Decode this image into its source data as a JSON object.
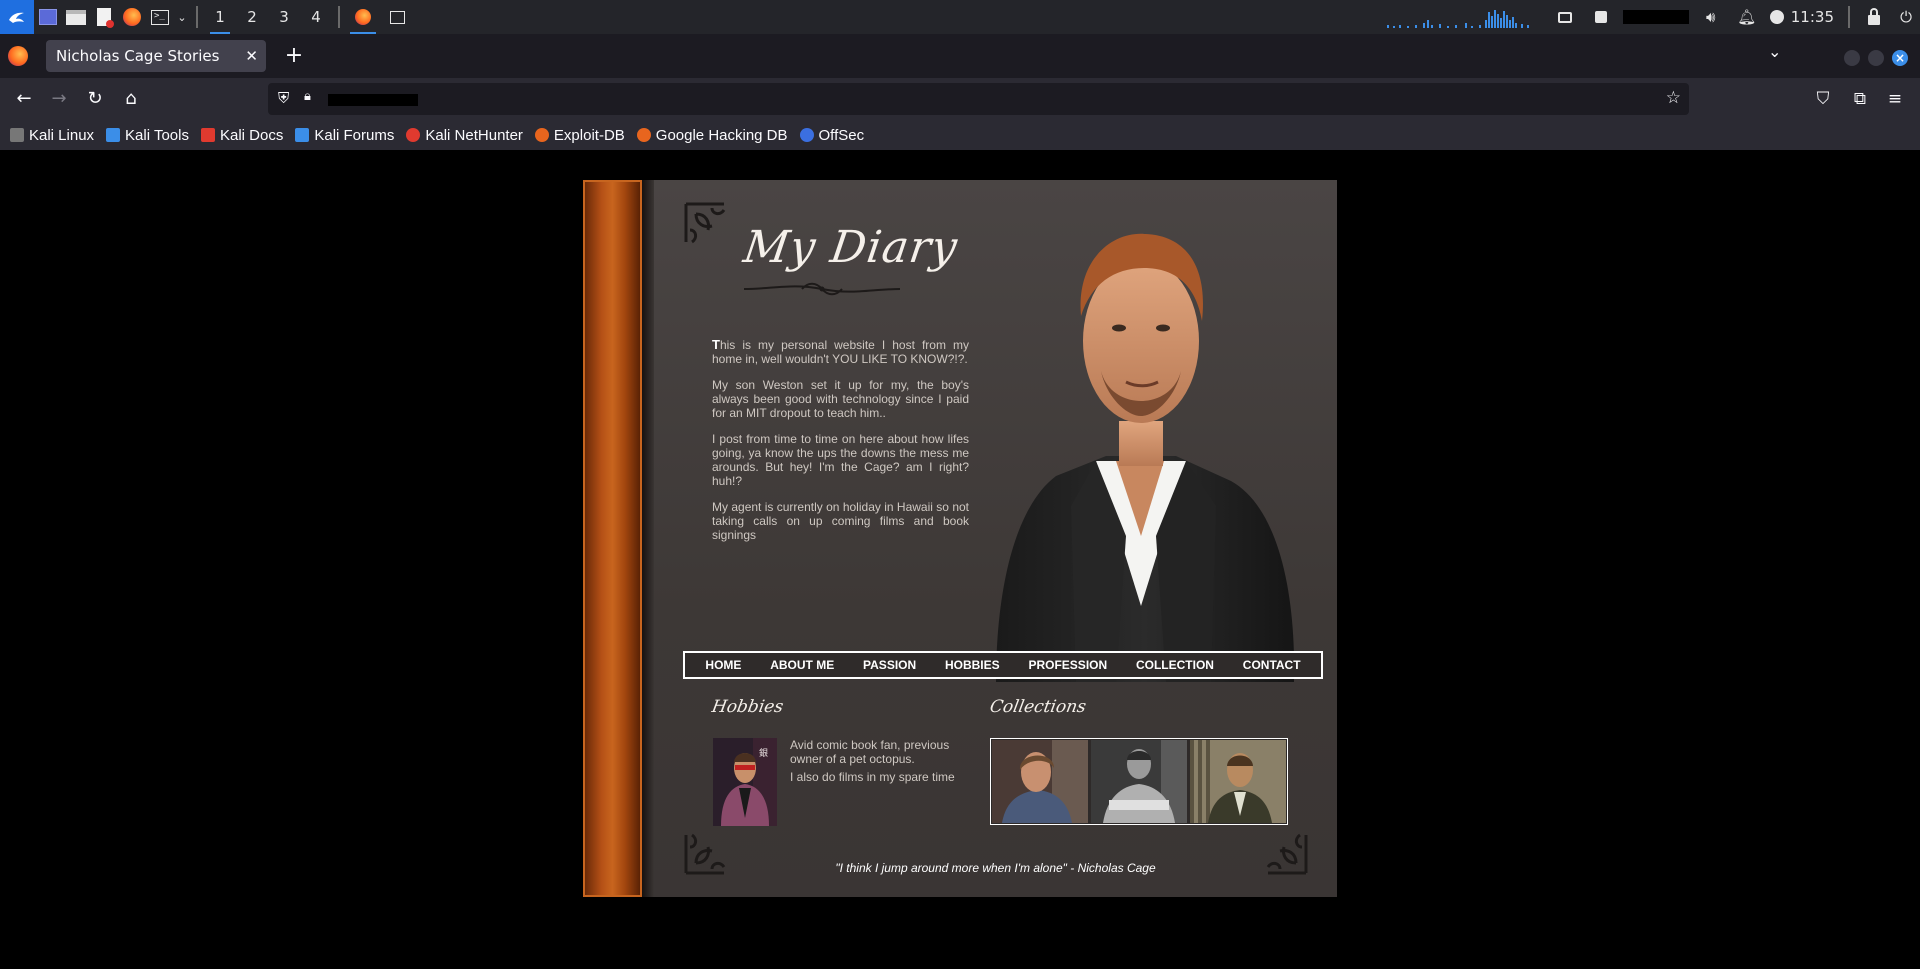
{
  "panel": {
    "workspaces": [
      "1",
      "2",
      "3",
      "4"
    ],
    "active_workspace": "1",
    "clock": "11:35"
  },
  "browser": {
    "tab_title": "Nicholas Cage Stories",
    "bookmarks": [
      {
        "label": "Kali Linux",
        "icon": "kali-dragon-icon",
        "color": "#e6e6e6"
      },
      {
        "label": "Kali Tools",
        "icon": "kali-tools-icon",
        "color": "#3b8ee8"
      },
      {
        "label": "Kali Docs",
        "icon": "kali-docs-icon",
        "color": "#e03a2f"
      },
      {
        "label": "Kali Forums",
        "icon": "kali-forums-icon",
        "color": "#3b8ee8"
      },
      {
        "label": "Kali NetHunter",
        "icon": "nethunter-icon",
        "color": "#e03a2f"
      },
      {
        "label": "Exploit-DB",
        "icon": "exploit-db-icon",
        "color": "#e8651e"
      },
      {
        "label": "Google Hacking DB",
        "icon": "ghdb-icon",
        "color": "#e8651e"
      },
      {
        "label": "OffSec",
        "icon": "offsec-icon",
        "color": "#3b6fe0"
      }
    ]
  },
  "site": {
    "title": "My Diary",
    "intro_first_letter": "T",
    "intro_p1_rest": "his is my personal website I host from my home in, well wouldn't YOU LIKE TO KNOW?!?.",
    "intro_p2": "My son Weston set it up for my, the boy's always been good with technology since I paid for an MIT dropout to teach him..",
    "intro_p3": "I post from time to time on here about how lifes going, ya know the ups the downs the mess me arounds. But hey! I'm the Cage? am I right? huh!?",
    "intro_p4": "My agent is currently on holiday in Hawaii so not taking calls on up coming films and book signings",
    "nav": [
      "HOME",
      "ABOUT ME",
      "PASSION",
      "HOBBIES",
      "PROFESSION",
      "COLLECTION",
      "CONTACT"
    ],
    "hobbies_heading": "Hobbies",
    "hobbies_text_1": "Avid comic book fan, previous owner of a pet octopus.",
    "hobbies_text_2": "I also do films in my spare time",
    "collections_heading": "Collections",
    "quote": "\"I think I jump around more when I'm alone\" - Nicholas Cage"
  },
  "colors": {
    "spine": "#b55016",
    "page_bg": "#4a4544",
    "accent_blue": "#3b8ee8"
  }
}
